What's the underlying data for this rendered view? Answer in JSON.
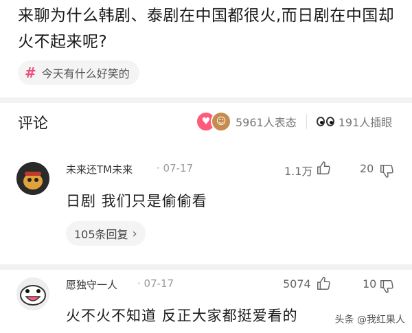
{
  "post": {
    "title": "来聊为什么韩剧、泰剧在中国都很火,而日剧在中国却火不起来呢?",
    "topic": "今天有什么好笑的"
  },
  "comments_section": {
    "title": "评论",
    "reactions_count": "5961人表态",
    "eye_count": "191人插眼"
  },
  "comments": [
    {
      "username": "未来还TM未来",
      "date": "· 07-17",
      "likes": "1.1万",
      "dislikes": "20",
      "text": "日剧 我们只是偷偷看",
      "replies": "105条回复"
    },
    {
      "username": "愿独守一人",
      "date": "· 07-17",
      "likes": "5074",
      "dislikes": "10",
      "text": "火不火不知道 反正大家都挺爱看的"
    }
  ],
  "watermark": "头条 @我红果人",
  "colors": {
    "accent": "#e8507a",
    "heart": "#ff5a79"
  }
}
